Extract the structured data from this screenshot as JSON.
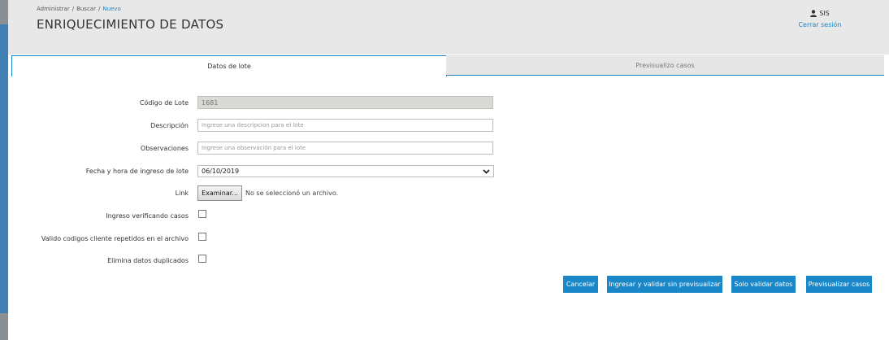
{
  "breadcrumb": {
    "items": [
      "Administrar",
      "Buscar"
    ],
    "current": "Nuevo",
    "separator": "/"
  },
  "header": {
    "title": "ENRIQUECIMIENTO DE DATOS"
  },
  "user": {
    "name": "SIS",
    "logout_label": "Cerrar sesión",
    "icon": "user-icon"
  },
  "tabs": [
    {
      "label": "Datos de lote",
      "active": true
    },
    {
      "label": "Previsualizo casos",
      "active": false
    }
  ],
  "form": {
    "lot_code": {
      "label": "Código de Lote",
      "value": "1681"
    },
    "description": {
      "label": "Descripción",
      "placeholder": "Ingrese una descripcion para el lote"
    },
    "observations": {
      "label": "Observaciones",
      "placeholder": "Ingrese una observación para el lote"
    },
    "date": {
      "label": "Fecha y hora de ingreso de lote",
      "value": "06/10/2019"
    },
    "link": {
      "label": "Link",
      "button_label": "Examinar...",
      "status": "No se seleccionó un archivo."
    },
    "checks": [
      {
        "label": "Ingreso verificando casos",
        "checked": false
      },
      {
        "label": "Valido codigos cliente repetidos en el archivo",
        "checked": false
      },
      {
        "label": "Elimina datos duplicados",
        "checked": false
      }
    ]
  },
  "actions": {
    "cancel": "Cancelar",
    "ingest_validate": "Ingresar y validar sin previsualizar",
    "validate_only": "Solo validar datos",
    "preview": "Previsualizar casos"
  },
  "colors": {
    "accent": "#1a87c9",
    "header_bg": "#e8e8e8",
    "readonly_bg": "#d9d9d5"
  }
}
